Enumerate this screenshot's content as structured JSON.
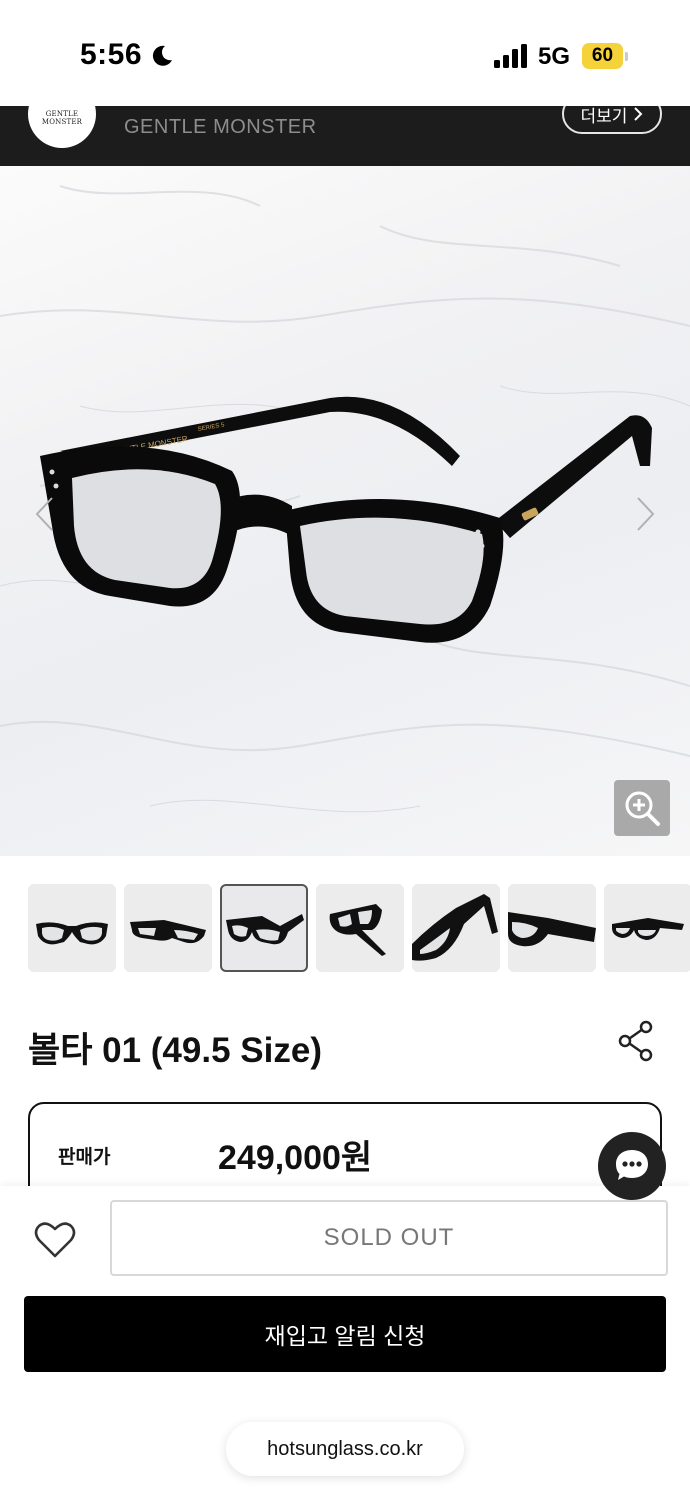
{
  "status_bar": {
    "time": "5:56",
    "network": "5G",
    "battery": "60",
    "icons": [
      "moon-icon",
      "signal-icon",
      "battery-icon"
    ]
  },
  "brand_bar": {
    "logo_text": "GENTLE MONSTER",
    "name": "GENTLE MONSTER",
    "more_label": "더보기"
  },
  "product_image": {
    "frame_print": "GENTLE MONSTER",
    "frame_series": "SERIES 5"
  },
  "thumbnails": {
    "count_visible": 7,
    "selected_index": 2
  },
  "product": {
    "title": "볼타 01 (49.5 Size)",
    "price_label": "판매가",
    "price": "249,000원"
  },
  "actions": {
    "sold_out_label": "SOLD OUT",
    "restock_label": "재입고 알림 신청"
  },
  "browser": {
    "url": "hotsunglass.co.kr"
  },
  "colors": {
    "brand_bar": "#1c1c1c",
    "battery": "#f5d13a",
    "primary_button": "#000000"
  }
}
